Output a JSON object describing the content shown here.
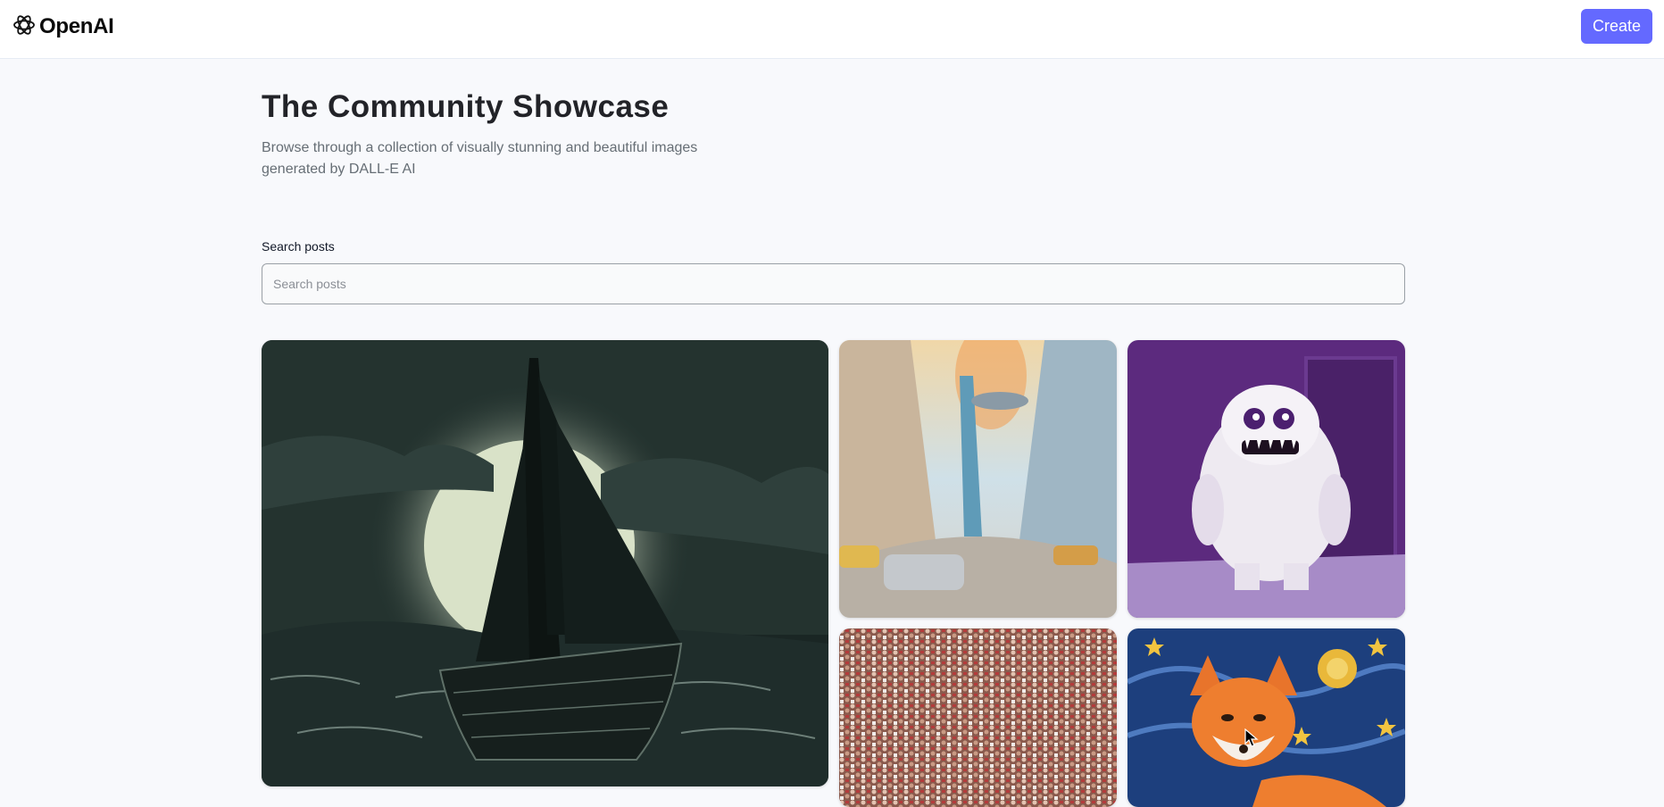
{
  "header": {
    "logo_text": "OpenAI",
    "logo_icon": "openai-logo-icon",
    "create_label": "Create"
  },
  "main": {
    "title": "The Community Showcase",
    "subtitle": "Browse through a collection of visually stunning and beautiful images generated by DALL-E AI",
    "search": {
      "label": "Search posts",
      "placeholder": "Search posts",
      "value": ""
    }
  },
  "colors": {
    "accent": "#6469ff",
    "background": "#f8f9fc"
  }
}
